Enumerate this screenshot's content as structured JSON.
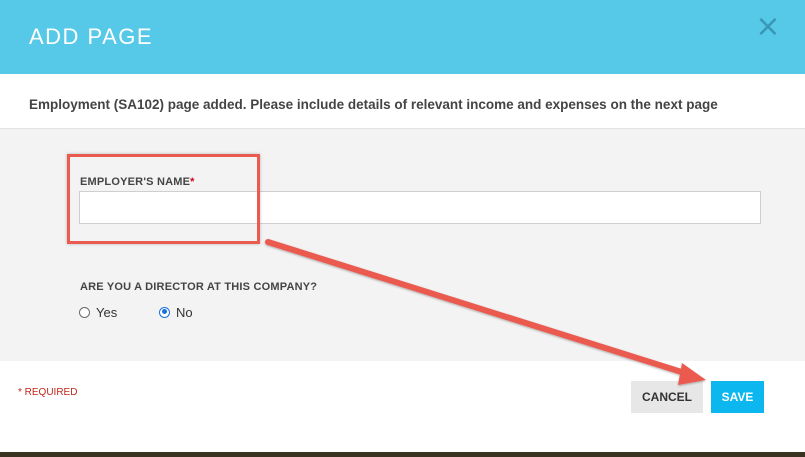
{
  "dialog": {
    "title": "ADD PAGE",
    "close_symbol": "×",
    "close_icon": "close-icon",
    "message": "Employment (SA102) page added. Please include details of relevant income and expenses on the next page"
  },
  "form": {
    "employer_name": {
      "label": "EMPLOYER'S NAME",
      "required_marker": "*",
      "value": "",
      "placeholder": ""
    },
    "director": {
      "label": "ARE YOU A DIRECTOR AT THIS COMPANY?",
      "options": [
        {
          "label": "Yes",
          "selected": false
        },
        {
          "label": "No",
          "selected": true
        }
      ]
    }
  },
  "footer": {
    "required_note": "* REQUIRED",
    "cancel_label": "CANCEL",
    "save_label": "SAVE"
  },
  "colors": {
    "header": "#56c8e8",
    "save_button": "#0cb7ef",
    "annotation": "#ea5a4f",
    "required": "#c0271b"
  }
}
